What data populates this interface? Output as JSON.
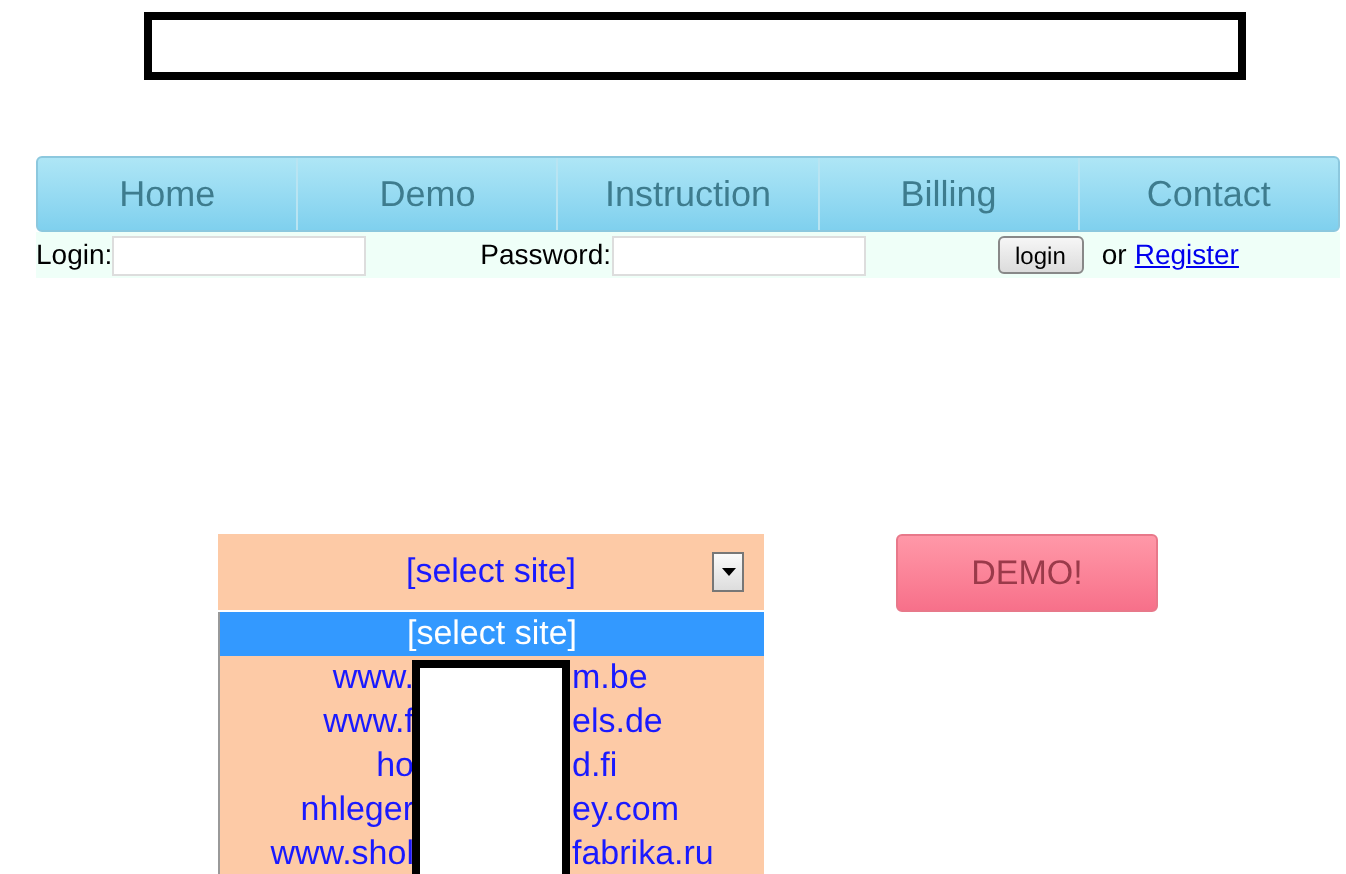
{
  "nav": [
    {
      "label": "Home"
    },
    {
      "label": "Demo"
    },
    {
      "label": "Instruction"
    },
    {
      "label": "Billing"
    },
    {
      "label": "Contact"
    }
  ],
  "login_bar": {
    "login_label": "Login:",
    "password_label": "Password:",
    "login_button": "login",
    "or_text": "or",
    "register_link": "Register"
  },
  "site_select": {
    "value": "[select site]",
    "options": [
      {
        "text_start": "[select site]",
        "selected": true
      },
      {
        "text_start": "www.",
        "text_end": "m.be",
        "selected": false
      },
      {
        "text_start": "www.f",
        "text_end": "els.de",
        "selected": false
      },
      {
        "text_start": "ho",
        "text_end": "d.fi",
        "selected": false
      },
      {
        "text_start": "nhleger",
        "text_end": "ey.com",
        "selected": false
      },
      {
        "text_start": "www.shol",
        "text_end": "fabrika.ru",
        "selected": false
      }
    ]
  },
  "demo_button": "DEMO!"
}
